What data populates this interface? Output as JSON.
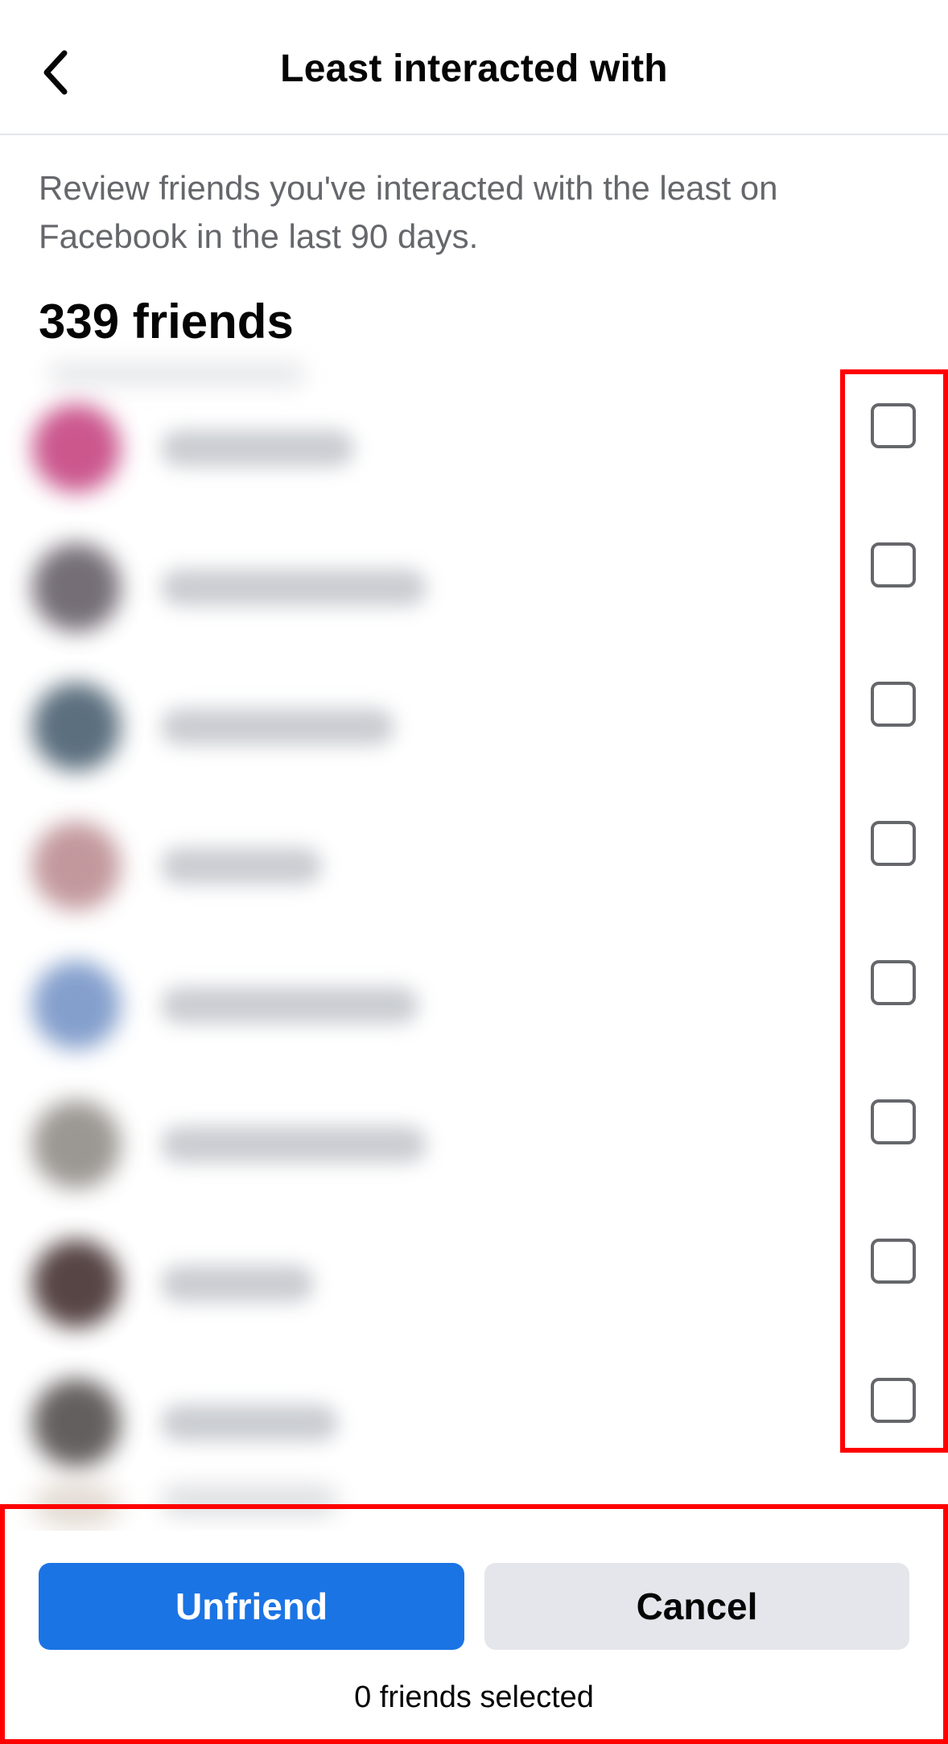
{
  "header": {
    "title": "Least interacted with",
    "back_icon": "chevron-left-icon"
  },
  "description": "Review friends you've interacted with the least on Facebook in the last 90 days.",
  "friend_count_label": "339 friends",
  "friends": [
    {
      "avatar_color": "#c23a7a",
      "checked": false
    },
    {
      "avatar_color": "#5d5560",
      "checked": false
    },
    {
      "avatar_color": "#3f5668",
      "checked": false
    },
    {
      "avatar_color": "#b8878c",
      "checked": false
    },
    {
      "avatar_color": "#6f8fc4",
      "checked": false
    },
    {
      "avatar_color": "#8a8680",
      "checked": false
    },
    {
      "avatar_color": "#3a2424",
      "checked": false
    },
    {
      "avatar_color": "#4a4444",
      "checked": false
    }
  ],
  "footer": {
    "unfriend_label": "Unfriend",
    "cancel_label": "Cancel",
    "selected_label": "0 friends selected"
  },
  "colors": {
    "primary_button": "#1b74e4",
    "secondary_button": "#e4e6eb",
    "highlight": "#ff0000"
  }
}
